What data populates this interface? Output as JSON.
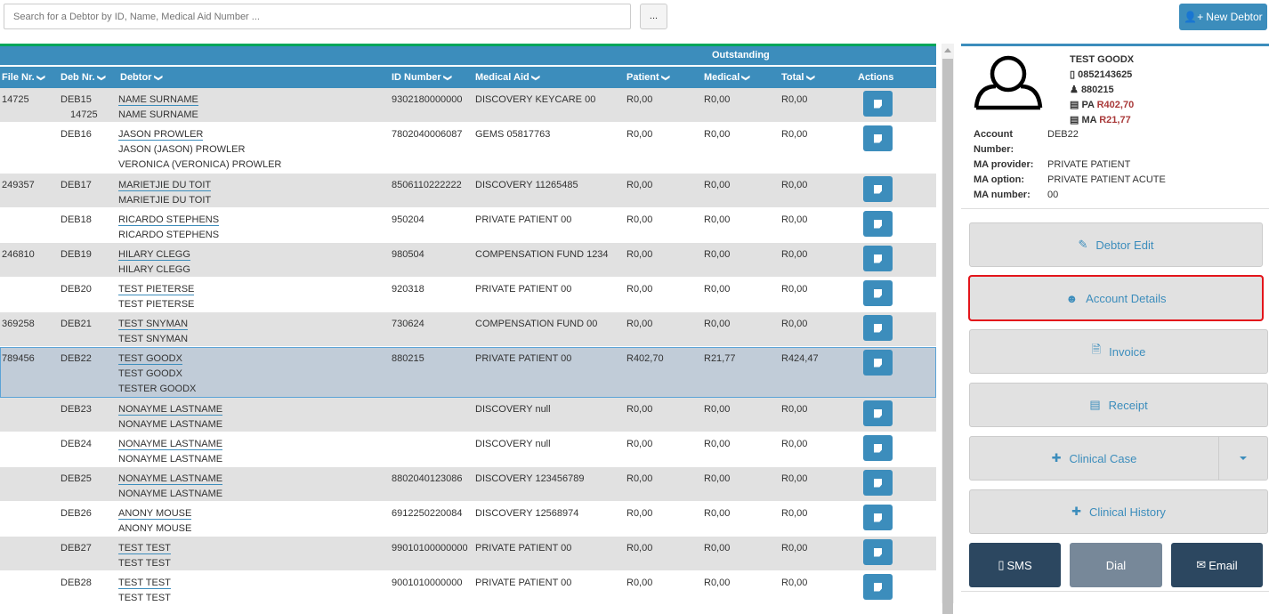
{
  "search": {
    "placeholder": "Search for a Debtor by ID, Name, Medical Aid Number ...",
    "more_label": "..."
  },
  "new_debtor_label": "New Debtor",
  "table": {
    "group_header": "Outstanding",
    "columns": [
      "File Nr.",
      "Deb Nr.",
      "Debtor",
      "ID Number",
      "Medical Aid",
      "Patient",
      "Medical",
      "Total",
      "Actions"
    ],
    "rows": [
      {
        "file": "14725",
        "deb": "DEB15",
        "deb2": "14725",
        "names": [
          "NAME SURNAME",
          "NAME SURNAME"
        ],
        "id": "9302180000000",
        "aid": "DISCOVERY KEYCARE 00",
        "patient": "R0,00",
        "medical": "R0,00",
        "total": "R0,00"
      },
      {
        "file": "",
        "deb": "DEB16",
        "names": [
          "JASON PROWLER",
          "JASON (JASON) PROWLER",
          "VERONICA (VERONICA) PROWLER"
        ],
        "id": "7802040006087",
        "aid": "GEMS 05817763",
        "patient": "R0,00",
        "medical": "R0,00",
        "total": "R0,00"
      },
      {
        "file": "249357",
        "deb": "DEB17",
        "names": [
          "MARIETJIE DU TOIT",
          "MARIETJIE DU TOIT"
        ],
        "id": "8506110222222",
        "aid": "DISCOVERY 11265485",
        "patient": "R0,00",
        "medical": "R0,00",
        "total": "R0,00"
      },
      {
        "file": "",
        "deb": "DEB18",
        "names": [
          "RICARDO STEPHENS",
          "RICARDO STEPHENS"
        ],
        "id": "950204",
        "aid": "PRIVATE PATIENT 00",
        "patient": "R0,00",
        "medical": "R0,00",
        "total": "R0,00"
      },
      {
        "file": "246810",
        "deb": "DEB19",
        "names": [
          "HILARY CLEGG",
          "HILARY CLEGG"
        ],
        "id": "980504",
        "aid": "COMPENSATION FUND 1234",
        "patient": "R0,00",
        "medical": "R0,00",
        "total": "R0,00"
      },
      {
        "file": "",
        "deb": "DEB20",
        "names": [
          "TEST PIETERSE",
          "TEST PIETERSE"
        ],
        "id": "920318",
        "aid": "PRIVATE PATIENT 00",
        "patient": "R0,00",
        "medical": "R0,00",
        "total": "R0,00"
      },
      {
        "file": "369258",
        "deb": "DEB21",
        "names": [
          "TEST SNYMAN",
          "TEST SNYMAN"
        ],
        "id": "730624",
        "aid": "COMPENSATION FUND 00",
        "patient": "R0,00",
        "medical": "R0,00",
        "total": "R0,00"
      },
      {
        "file": "789456",
        "deb": "DEB22",
        "names": [
          "TEST GOODX",
          "TEST GOODX",
          "TESTER GOODX"
        ],
        "id": "880215",
        "aid": "PRIVATE PATIENT 00",
        "patient": "R402,70",
        "medical": "R21,77",
        "total": "R424,47",
        "selected": true
      },
      {
        "file": "",
        "deb": "DEB23",
        "names": [
          "NONAYME LASTNAME",
          "NONAYME LASTNAME"
        ],
        "id": "",
        "aid": "DISCOVERY null",
        "patient": "R0,00",
        "medical": "R0,00",
        "total": "R0,00"
      },
      {
        "file": "",
        "deb": "DEB24",
        "names": [
          "NONAYME LASTNAME",
          "NONAYME LASTNAME"
        ],
        "id": "",
        "aid": "DISCOVERY null",
        "patient": "R0,00",
        "medical": "R0,00",
        "total": "R0,00"
      },
      {
        "file": "",
        "deb": "DEB25",
        "names": [
          "NONAYME LASTNAME",
          "NONAYME LASTNAME"
        ],
        "id": "8802040123086",
        "aid": "DISCOVERY 123456789",
        "patient": "R0,00",
        "medical": "R0,00",
        "total": "R0,00"
      },
      {
        "file": "",
        "deb": "DEB26",
        "names": [
          "ANONY MOUSE",
          "ANONY MOUSE"
        ],
        "id": "6912250220084",
        "aid": "DISCOVERY 12568974",
        "patient": "R0,00",
        "medical": "R0,00",
        "total": "R0,00"
      },
      {
        "file": "",
        "deb": "DEB27",
        "names": [
          "TEST TEST",
          "TEST TEST"
        ],
        "id": "99010100000000",
        "aid": "PRIVATE PATIENT 00",
        "patient": "R0,00",
        "medical": "R0,00",
        "total": "R0,00"
      },
      {
        "file": "",
        "deb": "DEB28",
        "names": [
          "TEST TEST",
          "TEST TEST"
        ],
        "id": "9001010000000",
        "aid": "PRIVATE PATIENT 00",
        "patient": "R0,00",
        "medical": "R0,00",
        "total": "R0,00"
      }
    ]
  },
  "panel": {
    "name": "TEST GOODX",
    "phone": "0852143625",
    "id": "880215",
    "pa_label": "PA",
    "pa_amount": "R402,70",
    "ma_label": "MA",
    "ma_amount": "R21,77",
    "fields": [
      {
        "label": "Account Number:",
        "value": "DEB22"
      },
      {
        "label": "MA provider:",
        "value": "PRIVATE PATIENT"
      },
      {
        "label": "MA option:",
        "value": "PRIVATE PATIENT ACUTE"
      },
      {
        "label": "MA number:",
        "value": "00"
      }
    ],
    "buttons": {
      "debtor_edit": "Debtor Edit",
      "account_details": "Account Details",
      "invoice": "Invoice",
      "receipt": "Receipt",
      "clinical_case": "Clinical Case",
      "clinical_history": "Clinical History",
      "sms": "SMS",
      "dial": "Dial",
      "email": "Email"
    },
    "colors": {
      "primary": "#3c8dbc",
      "dark": "#2c4760",
      "dial": "#778899",
      "highlight": "#e3151b",
      "amount": "#a93a3a"
    }
  }
}
